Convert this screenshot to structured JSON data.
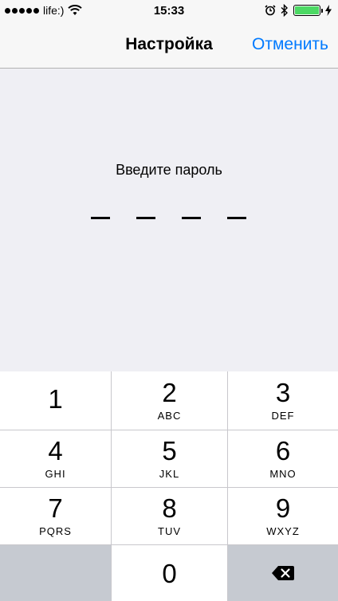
{
  "status_bar": {
    "carrier": "life:)",
    "time": "15:33",
    "signal_dots": 5,
    "battery_level": 1.0,
    "battery_color": "#4cd964",
    "icons": [
      "signal-icon",
      "wifi-icon",
      "alarm-icon",
      "bluetooth-icon",
      "battery-icon",
      "charging-icon"
    ]
  },
  "nav": {
    "title": "Настройка",
    "cancel_label": "Отменить",
    "accent": "#007aff"
  },
  "passcode": {
    "prompt": "Введите пароль",
    "digits_entered": 0,
    "length": 4
  },
  "keypad": {
    "keys": [
      {
        "digit": "1",
        "letters": ""
      },
      {
        "digit": "2",
        "letters": "ABC"
      },
      {
        "digit": "3",
        "letters": "DEF"
      },
      {
        "digit": "4",
        "letters": "GHI"
      },
      {
        "digit": "5",
        "letters": "JKL"
      },
      {
        "digit": "6",
        "letters": "MNO"
      },
      {
        "digit": "7",
        "letters": "PQRS"
      },
      {
        "digit": "8",
        "letters": "TUV"
      },
      {
        "digit": "9",
        "letters": "WXYZ"
      },
      {
        "digit": "0",
        "letters": ""
      }
    ],
    "delete_icon": "backspace-icon"
  }
}
